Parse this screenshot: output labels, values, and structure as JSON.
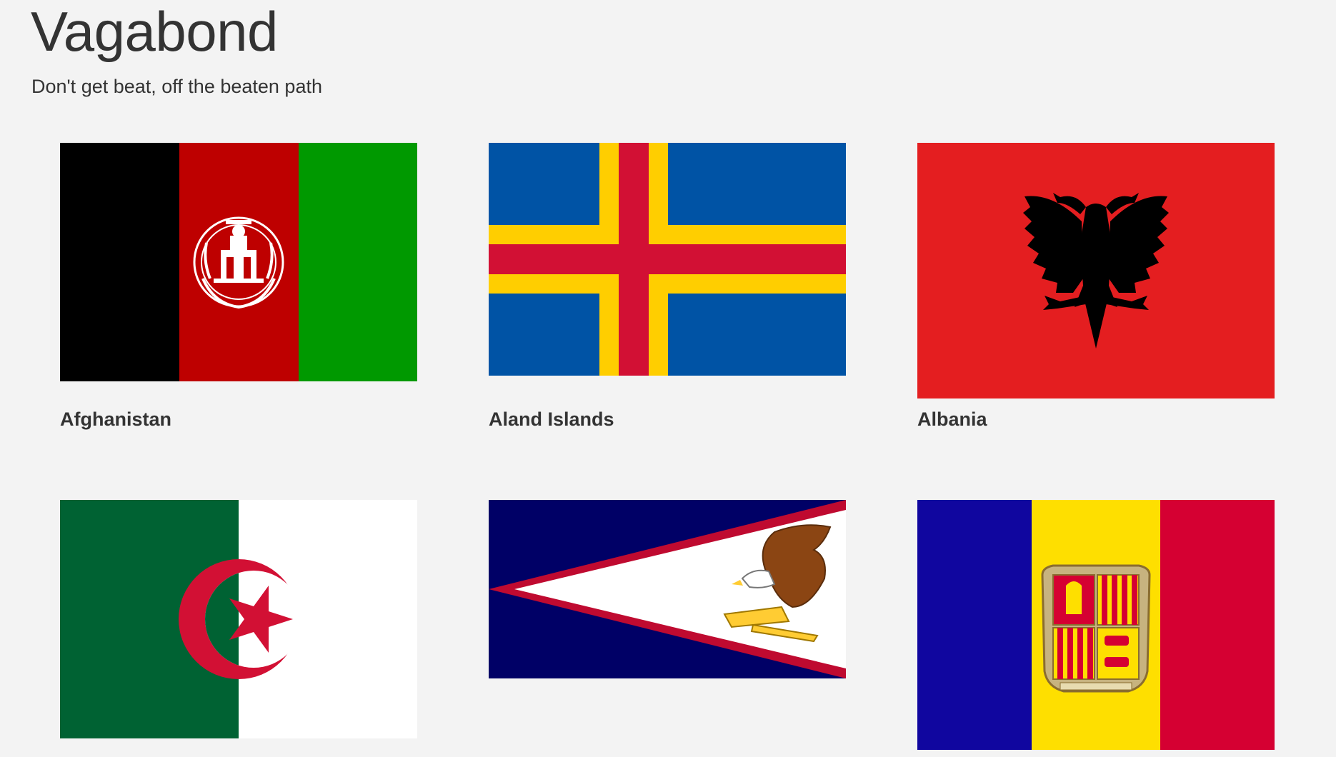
{
  "header": {
    "title": "Vagabond",
    "tagline": "Don't get beat, off the beaten path"
  },
  "countries": [
    {
      "name": "Afghanistan",
      "flag_icon": "flag-afghanistan-icon",
      "colors": [
        "#000000",
        "#be0000",
        "#009900"
      ]
    },
    {
      "name": "Aland Islands",
      "flag_icon": "flag-aland-islands-icon",
      "colors": [
        "#0053a5",
        "#ffce00",
        "#d21034"
      ]
    },
    {
      "name": "Albania",
      "flag_icon": "flag-albania-icon",
      "colors": [
        "#e41e20",
        "#000000"
      ]
    },
    {
      "name": "",
      "flag_icon": "flag-algeria-icon",
      "colors": [
        "#006233",
        "#ffffff",
        "#d21034"
      ]
    },
    {
      "name": "",
      "flag_icon": "flag-american-samoa-icon",
      "colors": [
        "#000066",
        "#ffffff",
        "#bf0a30"
      ]
    },
    {
      "name": "",
      "flag_icon": "flag-andorra-icon",
      "colors": [
        "#10069f",
        "#fedf00",
        "#d50032"
      ]
    }
  ]
}
